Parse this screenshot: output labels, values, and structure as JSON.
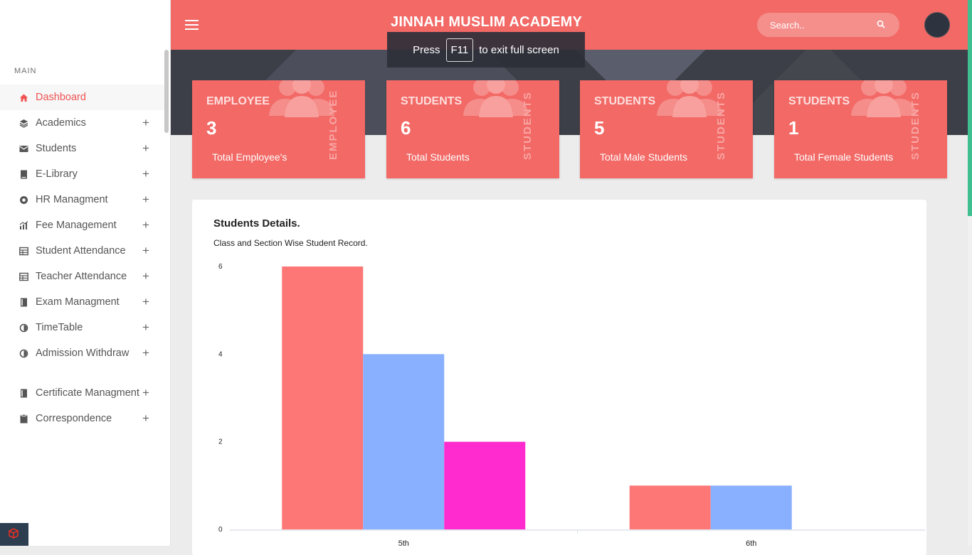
{
  "sidebar": {
    "section_label": "MAIN",
    "items": [
      {
        "label": "Dashboard",
        "icon": "home-icon",
        "active": true,
        "expandable": false
      },
      {
        "label": "Academics",
        "icon": "layers-icon",
        "expandable": true
      },
      {
        "label": "Students",
        "icon": "mail-icon",
        "expandable": true
      },
      {
        "label": "E-Library",
        "icon": "book-icon",
        "expandable": true
      },
      {
        "label": "HR Managment",
        "icon": "circle-icon",
        "expandable": true
      },
      {
        "label": "Fee Management",
        "icon": "bar-chart-icon",
        "expandable": true
      },
      {
        "label": "Student Attendance",
        "icon": "table-icon",
        "expandable": true
      },
      {
        "label": "Teacher Attendance",
        "icon": "table-icon",
        "expandable": true
      },
      {
        "label": "Exam Managment",
        "icon": "notebook-icon",
        "expandable": true
      },
      {
        "label": "TimeTable",
        "icon": "pie-icon",
        "expandable": true
      },
      {
        "label": "Admission Withdraw",
        "icon": "pie-icon",
        "expandable": true
      },
      {
        "label": "Certificate Managment",
        "icon": "notebook-icon",
        "expandable": true,
        "gap_before": true
      },
      {
        "label": "Correspondence",
        "icon": "clipboard-icon",
        "expandable": true
      }
    ],
    "expand_symbol": "+"
  },
  "header": {
    "title": "JINNAH MUSLIM ACADEMY",
    "search_placeholder": "Search.."
  },
  "fullscreen_notice": {
    "before": "Press",
    "key": "F11",
    "after": "to exit full screen"
  },
  "cards": [
    {
      "title": "EMPLOYEE",
      "value": "3",
      "label": "Total Employee's",
      "side": "EMPLOYEE"
    },
    {
      "title": "STUDENTS",
      "value": "6",
      "label": "Total Students",
      "side": "STUDENTS"
    },
    {
      "title": "STUDENTS",
      "value": "5",
      "label": "Total Male Students",
      "side": "STUDENTS"
    },
    {
      "title": "STUDENTS",
      "value": "1",
      "label": "Total Female Students",
      "side": "STUDENTS"
    }
  ],
  "panel": {
    "title": "Students Details.",
    "subtitle": "Class and Section Wise Student Record."
  },
  "chart_data": {
    "type": "bar",
    "categories": [
      "5th",
      "6th"
    ],
    "series": [
      {
        "color": "#fe7777",
        "values": [
          6,
          1
        ]
      },
      {
        "color": "#89b0ff",
        "values": [
          4,
          1
        ]
      },
      {
        "color": "#ff2bce",
        "values": [
          2,
          0
        ]
      }
    ],
    "yticks": [
      "0",
      "2",
      "4",
      "6"
    ],
    "ylim": [
      0,
      6
    ],
    "grid": false,
    "legend": "none",
    "title": "",
    "xlabel": "",
    "ylabel": ""
  },
  "colors": {
    "accent": "#f26966",
    "active_menu": "#f05252"
  }
}
